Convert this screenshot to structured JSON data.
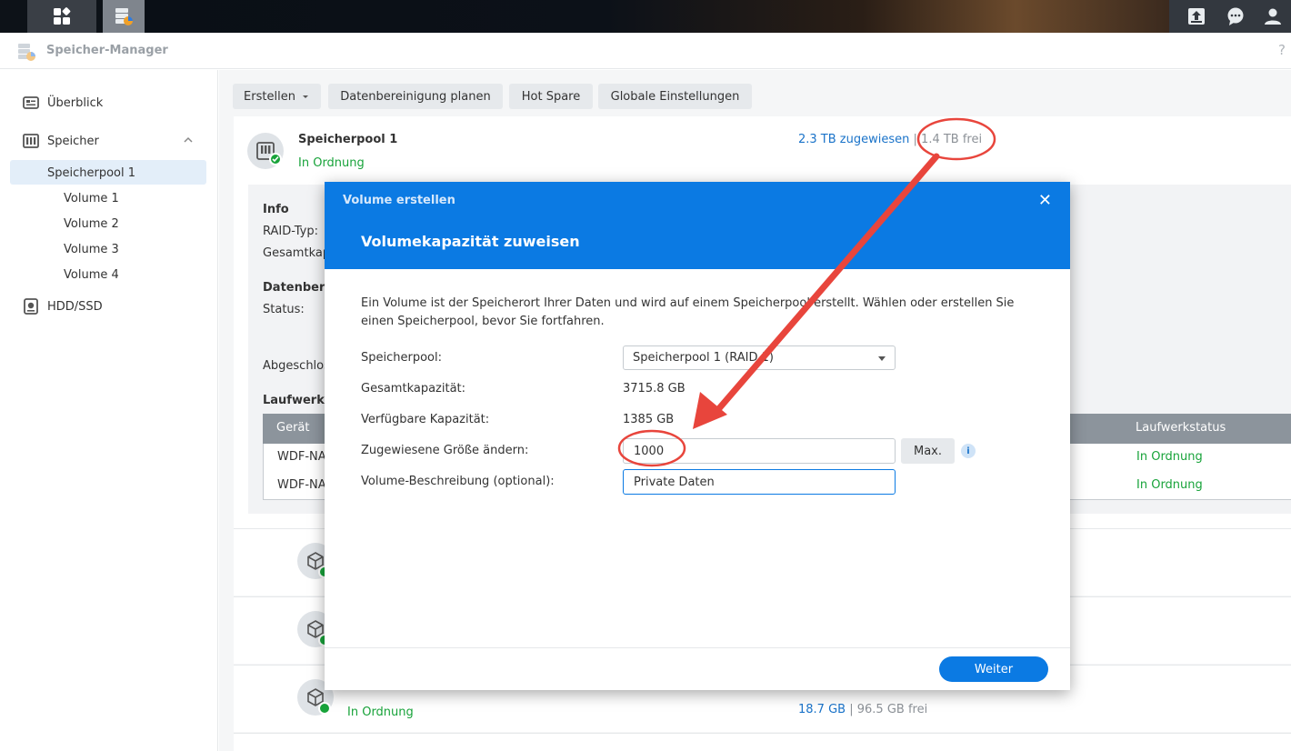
{
  "app": {
    "title": "Speicher-Manager",
    "help": "?"
  },
  "sidebar": {
    "items": [
      {
        "label": "Überblick"
      },
      {
        "label": "Speicher"
      },
      {
        "label": "Speicherpool 1"
      },
      {
        "label": "Volume 1"
      },
      {
        "label": "Volume 2"
      },
      {
        "label": "Volume 3"
      },
      {
        "label": "Volume 4"
      },
      {
        "label": "HDD/SSD"
      }
    ]
  },
  "toolbar": {
    "create": "Erstellen",
    "scrub": "Datenbereinigung planen",
    "hotspare": "Hot Spare",
    "global": "Globale Einstellungen"
  },
  "pool": {
    "name": "Speicherpool 1",
    "status": "In Ordnung",
    "allocated": "2.3 TB zugewiesen",
    "separator": "|",
    "free": "1.4 TB frei",
    "info_heading": "Info",
    "raid_label": "RAID-Typ:",
    "total_label": "Gesamtkap",
    "scrub_heading": "Datenber",
    "status_label": "Status:",
    "completed_label": "Abgeschlos",
    "drives_heading": "Laufwerk",
    "col_device": "Gerät",
    "col_drive_status": "Laufwerkstatus",
    "drives": [
      {
        "device": "WDF-NA",
        "status": "In Ordnung"
      },
      {
        "device": "WDF-NA",
        "status": "In Ordnung"
      }
    ]
  },
  "volumes": {
    "last": {
      "status": "In Ordnung",
      "used": "18.7 GB",
      "separator": "|",
      "free": "96.5 GB frei"
    }
  },
  "modal": {
    "subtitle": "Volume erstellen",
    "title": "Volumekapazität zuweisen",
    "close": "✕",
    "description": "Ein Volume ist der Speicherort Ihrer Daten und wird auf einem Speicherpool erstellt. Wählen oder erstellen Sie einen Speicherpool, bevor Sie fortfahren.",
    "pool_label": "Speicherpool:",
    "pool_value": "Speicherpool 1 (RAID 1)",
    "total_label": "Gesamtkapazität:",
    "total_value": "3715.8 GB",
    "avail_label": "Verfügbare Kapazität:",
    "avail_value": "1385 GB",
    "size_label": "Zugewiesene Größe ändern:",
    "size_value": "1000",
    "max_label": "Max.",
    "info_icon": "i",
    "desc_label": "Volume-Beschreibung (optional):",
    "desc_value": "Private Daten",
    "next": "Weiter"
  },
  "colors": {
    "accent": "#0b7ae3",
    "ok": "#18a33a",
    "annotation": "#e8453c"
  }
}
